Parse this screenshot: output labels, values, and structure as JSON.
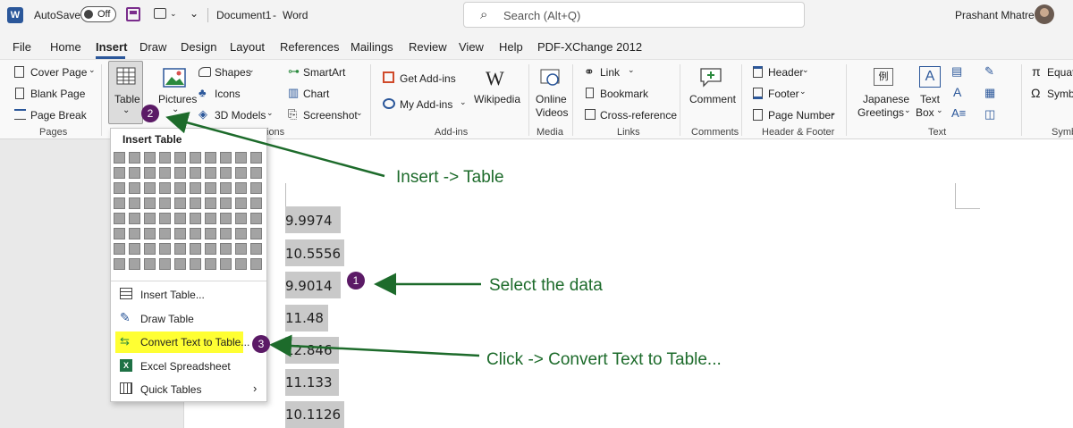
{
  "titlebar": {
    "autosave_label": "AutoSave",
    "autosave_state": "Off",
    "document_title": "Document1",
    "separator": "-",
    "app_name": "Word",
    "search_placeholder": "Search (Alt+Q)",
    "user_name": "Prashant Mhatre"
  },
  "tabs": [
    "File",
    "Home",
    "Insert",
    "Draw",
    "Design",
    "Layout",
    "References",
    "Mailings",
    "Review",
    "View",
    "Help",
    "PDF-XChange 2012"
  ],
  "active_tab": "Insert",
  "ribbon": {
    "pages": {
      "cover_page": "Cover Page",
      "blank_page": "Blank Page",
      "page_break": "Page Break",
      "label": "Pages"
    },
    "table": {
      "label": "Table"
    },
    "illustrations": {
      "pictures": "Pictures",
      "shapes": "Shapes",
      "icons": "Icons",
      "models": "3D Models",
      "smartart": "SmartArt",
      "chart": "Chart",
      "screenshot": "Screenshot",
      "label_fragment": "ions"
    },
    "addins": {
      "get": "Get Add-ins",
      "my": "My Add-ins",
      "wikipedia": "Wikipedia",
      "label": "Add-ins"
    },
    "media": {
      "online_videos_1": "Online",
      "online_videos_2": "Videos",
      "label": "Media"
    },
    "links": {
      "link": "Link",
      "bookmark": "Bookmark",
      "crossref": "Cross-reference",
      "label": "Links"
    },
    "comments": {
      "comment": "Comment",
      "label": "Comments"
    },
    "header_footer": {
      "header": "Header",
      "footer": "Footer",
      "page_number": "Page Number",
      "label": "Header & Footer"
    },
    "text": {
      "japanese_1": "Japanese",
      "japanese_2": "Greetings",
      "textbox_1": "Text",
      "textbox_2": "Box",
      "label": "Text"
    },
    "symbols": {
      "equation": "Equat",
      "symbol": "Symb",
      "label": "Symb"
    }
  },
  "insert_table_menu": {
    "title": "Insert Table",
    "items": [
      "Insert Table...",
      "Draw Table",
      "Convert Text to Table...",
      "Excel Spreadsheet",
      "Quick Tables"
    ],
    "highlighted_item": "Convert Text to Table..."
  },
  "document": {
    "values": [
      "9.9974",
      "10.5556",
      "9.9014",
      "11.48",
      "12.846",
      "11.133",
      "10.1126"
    ]
  },
  "annotations": {
    "step1": "Select the data",
    "step2": "Insert -> Table",
    "step3": "Click -> Convert Text to Table...",
    "badge1": "1",
    "badge2": "2",
    "badge3": "3"
  },
  "colors": {
    "annotation_green": "#1d6b2b",
    "badge_purple": "#5b1a66",
    "highlight_yellow": "#ffff33",
    "word_blue": "#2b579a"
  }
}
